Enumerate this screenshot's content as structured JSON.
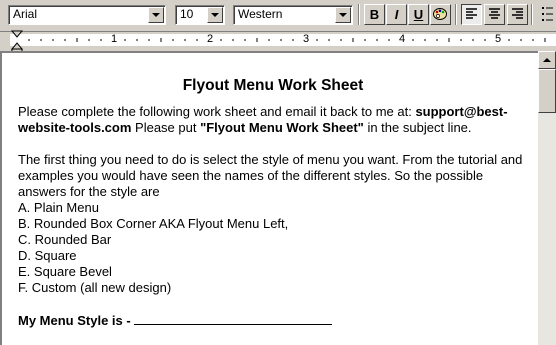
{
  "toolbar": {
    "font_name": "Arial",
    "font_size": "10",
    "charset": "Western",
    "bold_label": "B",
    "italic_label": "I",
    "underline_label": "U",
    "icons": [
      "bold-icon",
      "italic-icon",
      "underline-icon",
      "text-color-icon",
      "align-left-icon",
      "align-center-icon",
      "align-right-icon",
      "bullets-icon"
    ]
  },
  "ruler": {
    "labels": [
      "1",
      "2",
      "3",
      "4",
      "5"
    ]
  },
  "document": {
    "title": "Flyout Menu Work Sheet",
    "intro_prefix": "Please complete the following work sheet and email it back to me at: ",
    "email": "support@best-website-tools.com",
    "intro_middle": " Please put ",
    "subject": "\"Flyout Menu Work Sheet\"",
    "intro_suffix": " in the subject line.",
    "paragraph2": "The first thing you need to do is select the style of menu you want. From the tutorial and examples you would have seen the names of the different styles. So the possible answers for the style are",
    "options": [
      "A. Plain Menu",
      "B. Rounded Box Corner AKA Flyout Menu Left,",
      "C. Rounded Bar",
      "D. Square",
      "E. Square Bevel",
      "F. Custom (all new design)"
    ],
    "menu_style_label": "My Menu Style is - "
  }
}
